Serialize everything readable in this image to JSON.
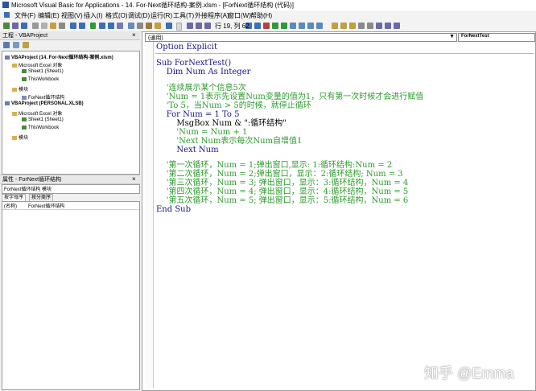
{
  "window": {
    "title": "Microsoft Visual Basic for Applications - 14. For-Next循环结构-案例.xlsm - [ForNext循环结构 (代码)]"
  },
  "menu": [
    "文件(F)",
    "编辑(E)",
    "视图(V)",
    "插入(I)",
    "格式(O)",
    "调试(D)",
    "运行(R)",
    "工具(T)",
    "外接程序(A)",
    "窗口(W)",
    "帮助(H)"
  ],
  "toolbar": {
    "position": "行 19, 列 62"
  },
  "project_panel": {
    "title": "工程 - VBAProject",
    "close": "×",
    "tree": [
      {
        "label": "VBAProject (14. For-Next循环结构-案例.xlsm)",
        "bold": true
      },
      {
        "label": "Microsoft Excel 对象",
        "bold": false
      },
      {
        "label": "Sheet1 (Sheet1)",
        "bold": false
      },
      {
        "label": "ThisWorkbook",
        "bold": false
      },
      {
        "label": "模块",
        "bold": false
      },
      {
        "label": "ForNext循环结构",
        "bold": false
      },
      {
        "label": "VBAProject (PERSONAL.XLSB)",
        "bold": true
      },
      {
        "label": "Microsoft Excel 对象",
        "bold": false
      },
      {
        "label": "Sheet1 (Sheet1)",
        "bold": false
      },
      {
        "label": "ThisWorkbook",
        "bold": false
      },
      {
        "label": "模块",
        "bold": false
      }
    ]
  },
  "properties_panel": {
    "title": "属性 - ForNext循环结构",
    "close": "×",
    "object": "ForNext循环结构 模块",
    "tabs": [
      "按字母序",
      "按分类序"
    ],
    "rows": [
      {
        "name": "(名称)",
        "value": "ForNext循环结构"
      }
    ]
  },
  "code_window": {
    "object_combo": "(通用)",
    "proc_combo": "ForNextTest",
    "lines": [
      {
        "text": "Option Explicit",
        "kind": "kw"
      },
      {
        "text": "Sub ForNextTest()",
        "kind": "kw"
      },
      {
        "text": "    Dim Num As Integer",
        "kind": "kw"
      },
      {
        "text": "    '连续展示某个信息5次",
        "kind": "cm"
      },
      {
        "text": "    'Num = 1表示先设置Num变量的值为1，只有第一次时候才会进行赋值",
        "kind": "cm"
      },
      {
        "text": "    'To 5，当Num > 5的时候，就停止循环",
        "kind": "cm"
      },
      {
        "text": "    For Num = 1 To 5",
        "kind": "kw"
      },
      {
        "text": "        MsgBox Num & \":循环结构\"",
        "kind": "tx"
      },
      {
        "text": "        'Num = Num + 1",
        "kind": "cm"
      },
      {
        "text": "        'Next Num表示每次Num自增值1",
        "kind": "cm"
      },
      {
        "text": "        Next Num",
        "kind": "kw"
      },
      {
        "text": "    '第一次循环，Num = 1;弹出窗口,显示: 1:循环结构:Num = 2",
        "kind": "cm"
      },
      {
        "text": "    '第二次循环，Num = 2;弹出窗口，显示：2:循环结构; Num = 3",
        "kind": "cm"
      },
      {
        "text": "    '第三次循环，Num = 3; 弹出窗口，显示：3:循环结构，Num = 4",
        "kind": "cm"
      },
      {
        "text": "    '第四次循环，Num = 4; 弹出窗口，显示：4:循环结构，Num = 5",
        "kind": "cm"
      },
      {
        "text": "    '第五次循环，Num = 5; 弹出窗口，显示：5:循环结构，Num = 6",
        "kind": "cm"
      },
      {
        "text": "End Sub",
        "kind": "kw"
      }
    ]
  },
  "watermark": "知乎 @Emma"
}
